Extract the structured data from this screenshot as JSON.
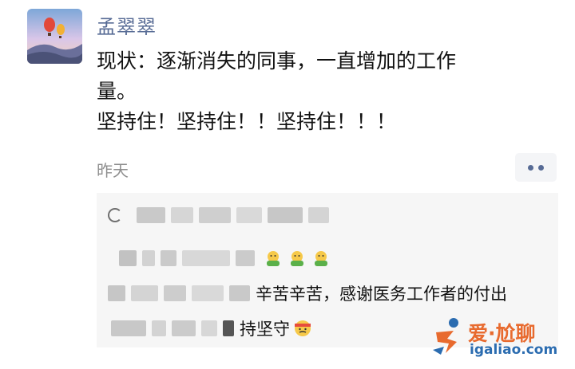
{
  "post": {
    "author": "孟翠翠",
    "lines": [
      "现状：逐渐消失的同事，一直增加的工作",
      "量。",
      "坚持住！坚持住！！坚持住！！！"
    ],
    "time": "昨天"
  },
  "comments": {
    "row2": "辛苦辛苦，感谢医务工作者的付出",
    "row3": "持坚守"
  },
  "watermark": {
    "title": "爱·尬聊",
    "url": "igaliao.com"
  },
  "colors": {
    "name_blue": "#576b95",
    "comment_bg": "#f6f6f6",
    "watermark_orange": "#e86a2e",
    "watermark_blue": "#2b6cb0"
  }
}
